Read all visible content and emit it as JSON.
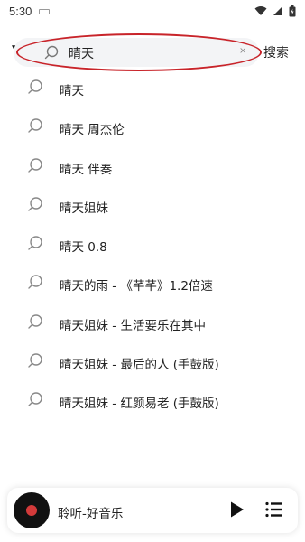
{
  "status_bar": {
    "time": "5:30"
  },
  "search": {
    "query": "晴天",
    "clear_symbol": "×",
    "button_label": "搜索",
    "caret_symbol": "▼"
  },
  "suggestions": [
    {
      "label": "晴天"
    },
    {
      "label": "晴天 周杰伦"
    },
    {
      "label": "晴天 伴奏"
    },
    {
      "label": "晴天姐妹"
    },
    {
      "label": "晴天 0.8"
    },
    {
      "label": "晴天的雨 - 《芊芊》1.2倍速"
    },
    {
      "label": "晴天姐妹 - 生活要乐在其中"
    },
    {
      "label": "晴天姐妹 - 最后的人 (手鼓版)"
    },
    {
      "label": "晴天姐妹 - 红颜易老 (手鼓版)"
    }
  ],
  "player": {
    "title": "聆听-好音乐"
  },
  "colors": {
    "highlight_ring": "#c8242a",
    "disc_center": "#d33a3a"
  }
}
